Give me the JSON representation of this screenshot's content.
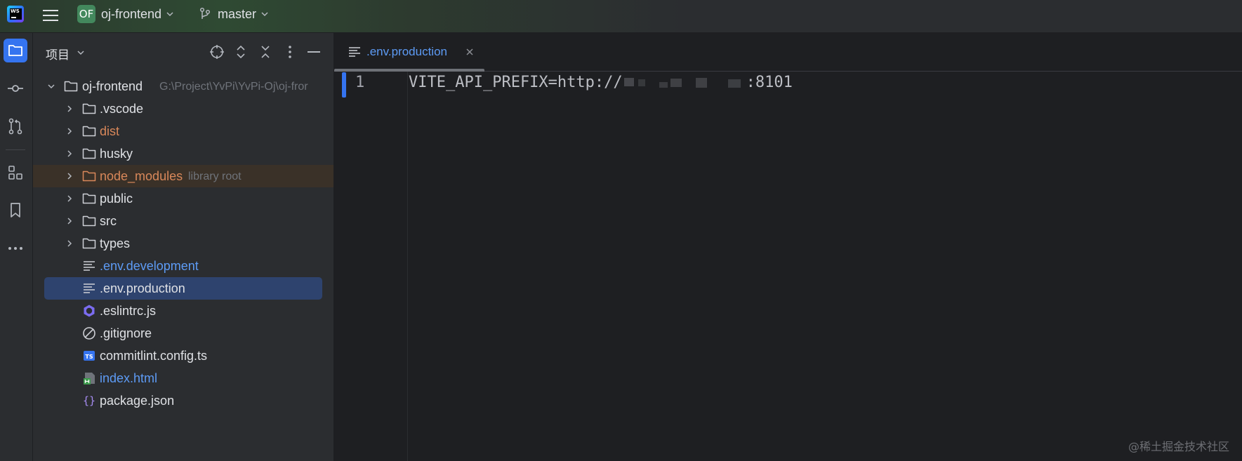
{
  "app": {
    "logo_text": "WS"
  },
  "titlebar": {
    "project_badge": "OF",
    "project_name": "oj-frontend",
    "branch_name": "master"
  },
  "project_panel": {
    "title": "项目",
    "tree": [
      {
        "label": "oj-frontend",
        "hint": "G:\\Project\\YvPi\\YvPi-Oj\\oj-fror",
        "kind": "folder",
        "expanded": true,
        "depth": 0
      },
      {
        "label": ".vscode",
        "kind": "folder",
        "depth": 1
      },
      {
        "label": "dist",
        "kind": "folder",
        "depth": 1,
        "color": "orange"
      },
      {
        "label": "husky",
        "kind": "folder",
        "depth": 1
      },
      {
        "label": "node_modules",
        "hint": "library root",
        "kind": "folder",
        "depth": 1,
        "color": "orange"
      },
      {
        "label": "public",
        "kind": "folder",
        "depth": 1
      },
      {
        "label": "src",
        "kind": "folder",
        "depth": 1
      },
      {
        "label": "types",
        "kind": "folder",
        "depth": 1
      },
      {
        "label": ".env.development",
        "kind": "text-file",
        "depth": 1,
        "color": "blue"
      },
      {
        "label": ".env.production",
        "kind": "text-file",
        "depth": 1,
        "selected": true
      },
      {
        "label": ".eslintrc.js",
        "kind": "eslint-file",
        "depth": 1
      },
      {
        "label": ".gitignore",
        "kind": "ignore-file",
        "depth": 1
      },
      {
        "label": "commitlint.config.ts",
        "kind": "ts-file",
        "depth": 1
      },
      {
        "label": "index.html",
        "kind": "html-file",
        "depth": 1,
        "color": "blue"
      },
      {
        "label": "package.json",
        "kind": "json-file",
        "depth": 1
      }
    ]
  },
  "editor": {
    "tab_label": ".env.production",
    "line_number": "1",
    "code_prefix": "VITE_API_PREFIX=http://",
    "code_suffix": ":8101"
  },
  "ts_badge": "TS",
  "json_glyph": "{}",
  "watermark": "@稀土掘金技术社区",
  "colors": {
    "accent": "#3574f0",
    "selection": "#2e436e",
    "orange_label": "#d9885a",
    "blue_label": "#5d9bf5",
    "library_row": "#3a3128"
  }
}
